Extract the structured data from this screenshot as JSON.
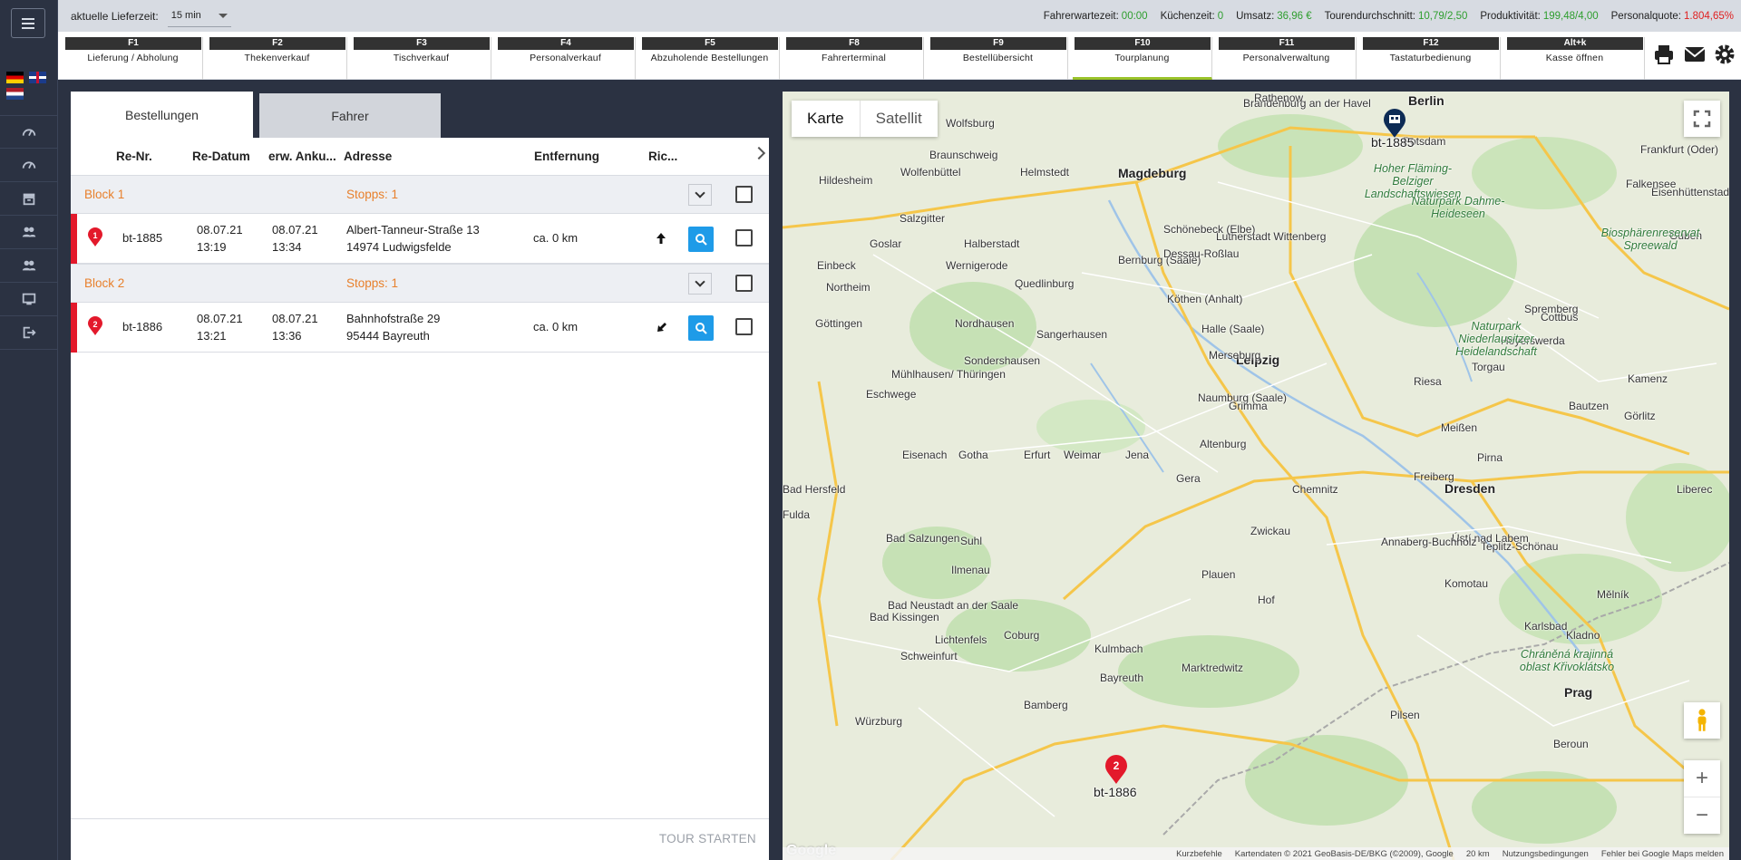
{
  "topbar": {
    "lieferzeit_label": "aktuelle Lieferzeit:",
    "lieferzeit_value": "15 min",
    "stats": [
      {
        "label": "Fahrerwartezeit:",
        "value": "00:00",
        "color": "green"
      },
      {
        "label": "Küchenzeit:",
        "value": "0",
        "color": "green"
      },
      {
        "label": "Umsatz:",
        "value": "36,96 €",
        "color": "green"
      },
      {
        "label": "Tourendurchschnitt:",
        "value": "10,79/2,50",
        "color": "green"
      },
      {
        "label": "Produktivität:",
        "value": "199,48/4,00",
        "color": "green"
      },
      {
        "label": "Personalquote:",
        "value": "1.804,65%",
        "color": "red"
      }
    ]
  },
  "ftabs": [
    {
      "key": "F1",
      "label": "Lieferung / Abholung"
    },
    {
      "key": "F2",
      "label": "Thekenverkauf"
    },
    {
      "key": "F3",
      "label": "Tischverkauf"
    },
    {
      "key": "F4",
      "label": "Personalverkauf"
    },
    {
      "key": "F5",
      "label": "Abzuholende Bestellungen"
    },
    {
      "key": "F8",
      "label": "Fahrerterminal"
    },
    {
      "key": "F9",
      "label": "Bestellübersicht"
    },
    {
      "key": "F10",
      "label": "Tourplanung",
      "active": true
    },
    {
      "key": "F11",
      "label": "Personalverwaltung"
    },
    {
      "key": "F12",
      "label": "Tastaturbedienung"
    },
    {
      "key": "Alt+k",
      "label": "Kasse öffnen"
    }
  ],
  "panel": {
    "tabs": [
      "Bestellungen",
      "Fahrer"
    ],
    "columns": [
      "Re-Nr.",
      "Re-Datum",
      "erw. Anku...",
      "Adresse",
      "Entfernung",
      "Ric..."
    ],
    "blocks": [
      {
        "label": "Block 1",
        "stops": "Stopps: 1",
        "order": {
          "num": "1",
          "id": "bt-1885",
          "date": "08.07.21",
          "time": "13:19",
          "eta_date": "08.07.21",
          "eta_time": "13:34",
          "street": "Albert-Tanneur-Straße 13",
          "city": "14974 Ludwigsfelde",
          "distance": "ca. 0 km",
          "direction": "north"
        }
      },
      {
        "label": "Block 2",
        "stops": "Stopps: 1",
        "order": {
          "num": "2",
          "id": "bt-1886",
          "date": "08.07.21",
          "time": "13:21",
          "eta_date": "08.07.21",
          "eta_time": "13:36",
          "street": "Bahnhofstraße 29",
          "city": "95444 Bayreuth",
          "distance": "ca. 0 km",
          "direction": "south-west"
        }
      }
    ],
    "tour_button": "TOUR STARTEN"
  },
  "map": {
    "type_buttons": [
      "Karte",
      "Satellit"
    ],
    "markers": [
      {
        "label": "bt-1885",
        "kind": "store"
      },
      {
        "label": "bt-1886",
        "kind": "stop",
        "num": "2"
      }
    ],
    "cities_big": [
      "Berlin",
      "Leipzig",
      "Dresden",
      "Magdeburg",
      "Prag"
    ],
    "cities": [
      "Wolfsburg",
      "Braunschweig",
      "Hildesheim",
      "Salzgitter",
      "Goslar",
      "Halberstadt",
      "Wernigerode",
      "Einbeck",
      "Northeim",
      "Göttingen",
      "Nordhausen",
      "Sangerhausen",
      "Bernburg (Saale)",
      "Dessau-Roßlau",
      "Lutherstadt Wittenberg",
      "Halle (Saale)",
      "Merseburg",
      "Naumburg (Saale)",
      "Weimar",
      "Erfurt",
      "Jena",
      "Gera",
      "Gotha",
      "Eisenach",
      "Mühlhausen/ Thüringen",
      "Chemnitz",
      "Zwickau",
      "Plauen",
      "Hof",
      "Coburg",
      "Bamberg",
      "Schweinfurt",
      "Kulmbach",
      "Bayreuth",
      "Würzburg",
      "Fulda",
      "Suhl",
      "Ilmenau",
      "Freiberg",
      "Meißen",
      "Riesa",
      "Torgau",
      "Cottbus",
      "Spremberg",
      "Hoyerswerda",
      "Bautzen",
      "Görlitz",
      "Pirna",
      "Potsdam",
      "Brandenburg an der Havel",
      "Frankfurt (Oder)",
      "Eisenhüttenstadt",
      "Guben",
      "Liberec",
      "Ústí nad Labem",
      "Teplitz-Schönau",
      "Komotau",
      "Karlsbad",
      "Mělník",
      "Kladno",
      "Pilsen",
      "Beroun",
      "Altenburg",
      "Grimma",
      "Wolfenbüttel",
      "Helmstedt",
      "Schönebeck (Elbe)",
      "Köthen (Anhalt)",
      "Quedlinburg",
      "Bad Hersfeld",
      "Bad Salzungen",
      "Bad Kissingen",
      "Bad Neustadt an der Saale",
      "Lichtenfels",
      "Marktredwitz",
      "Annaberg-Buchholz",
      "Sondershausen",
      "Eschwege",
      "Kamenz",
      "Rathenow",
      "Falkensee"
    ],
    "parks": [
      "Hoher Fläming-Belziger Landschaftswiesen",
      "Naturpark Dahme-Heideseen",
      "Biosphärenreservat Spreewald",
      "Naturpark Niederlausitzer Heidelandschaft",
      "Chráněná krajinná oblast Křivoklátsko"
    ],
    "attribution": [
      "Kurzbefehle",
      "Kartendaten © 2021 GeoBasis-DE/BKG (©2009), Google",
      "20 km",
      "Nutzungsbedingungen",
      "Fehler bei Google Maps melden"
    ],
    "google": "Google"
  }
}
